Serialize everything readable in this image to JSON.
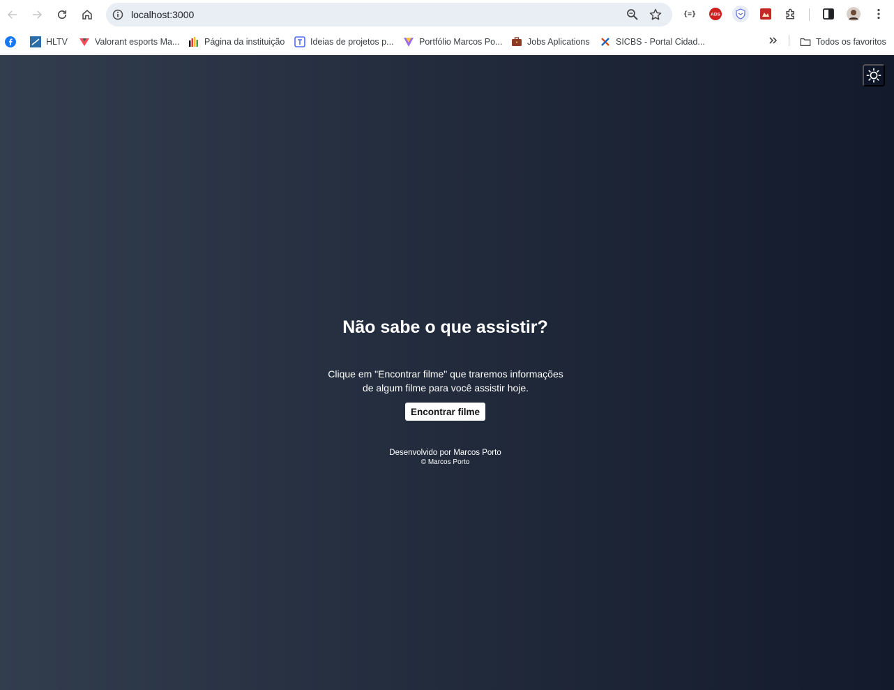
{
  "browser": {
    "url": "localhost:3000",
    "bookmarks": [
      {
        "label": "",
        "icon": "facebook-icon"
      },
      {
        "label": "HLTV",
        "icon": "hltv-icon"
      },
      {
        "label": "Valorant esports Ma...",
        "icon": "valorant-icon"
      },
      {
        "label": "Página da instituição",
        "icon": "institution-icon"
      },
      {
        "label": "Ideias de projetos p...",
        "icon": "ideas-icon"
      },
      {
        "label": "Portfólio Marcos Po...",
        "icon": "portfolio-icon"
      },
      {
        "label": "Jobs Aplications",
        "icon": "briefcase-icon"
      },
      {
        "label": "SICBS - Portal Cidad...",
        "icon": "sicbs-icon"
      }
    ],
    "all_bookmarks_label": "Todos os favoritos",
    "extension_labels": {
      "json": "{=}",
      "ads": "ADS"
    }
  },
  "page": {
    "headline": "Não sabe o que assistir?",
    "description_line1": "Clique em \"Encontrar filme\" que traremos informações",
    "description_line2": "de algum filme para você assistir hoje.",
    "find_button": "Encontrar filme",
    "footer_dev": "Desenvolvido por Marcos Porto",
    "footer_copy": "© Marcos Porto"
  },
  "colors": {
    "bg_left": "#323d4e",
    "bg_right": "#121a2c",
    "toggle_bg": "#0d1527"
  }
}
